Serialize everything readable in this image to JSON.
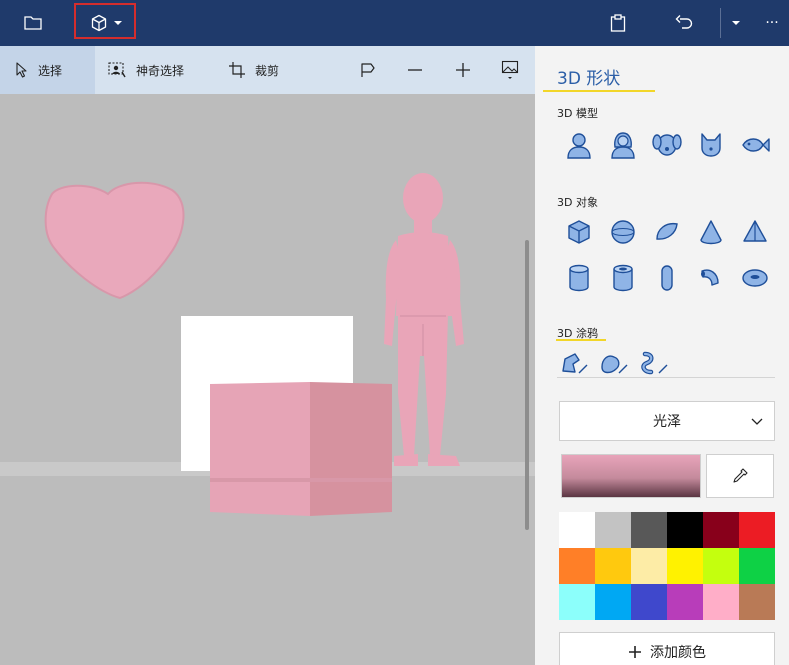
{
  "titlebar": {
    "icons": [
      "folder-icon",
      "3d-cube-icon",
      "chevron-down-icon",
      "paste-icon",
      "undo-icon",
      "chevron-down-icon",
      "more-icon"
    ],
    "more_label": "···"
  },
  "toolbar": {
    "tools": [
      {
        "label": "选择",
        "icon": "cursor-icon",
        "active": true
      },
      {
        "label": "神奇选择",
        "icon": "magic-select-icon",
        "active": false
      },
      {
        "label": "裁剪",
        "icon": "crop-icon",
        "active": false
      }
    ],
    "icon_buttons": [
      "flag-icon",
      "zoom-out-icon",
      "zoom-in-icon",
      "image-view-icon"
    ]
  },
  "panel": {
    "title": "3D 形状",
    "models_heading": "3D 模型",
    "models": [
      "man-icon",
      "woman-icon",
      "dog-icon",
      "cat-icon",
      "fish-icon"
    ],
    "objects_heading": "3D 对象",
    "objects": [
      "cube-icon",
      "sphere-icon",
      "hemisphere-icon",
      "cone-icon",
      "pyramid-icon",
      "cylinder-icon",
      "tube-icon",
      "capsule-icon",
      "curved-tube-icon",
      "torus-icon"
    ],
    "doodle_heading": "3D 涂鸦",
    "doodles": [
      "sharp-doodle-icon",
      "soft-doodle-icon",
      "tube-doodle-icon"
    ],
    "finish_value": "光泽",
    "eyedropper_icon": "eyedropper-icon",
    "palette": [
      "#ffffff",
      "#c3c3c3",
      "#585858",
      "#000000",
      "#88001b",
      "#ec1c24",
      "#ff7f27",
      "#ffc90e",
      "#fdeca6",
      "#fff200",
      "#c4ff0e",
      "#0ed145",
      "#8cfffb",
      "#00a8f3",
      "#3f48cc",
      "#b83dba",
      "#ffaec8",
      "#b97a56"
    ],
    "add_color_label": "添加颜色",
    "current_color": "#e8a4ba"
  },
  "colors": {
    "titlebar": "#1f3a6b",
    "accent": "#2b5ea7",
    "highlight": "#d42d2d",
    "underline": "#f2d629",
    "shape_pink": "#e8a4ba"
  }
}
